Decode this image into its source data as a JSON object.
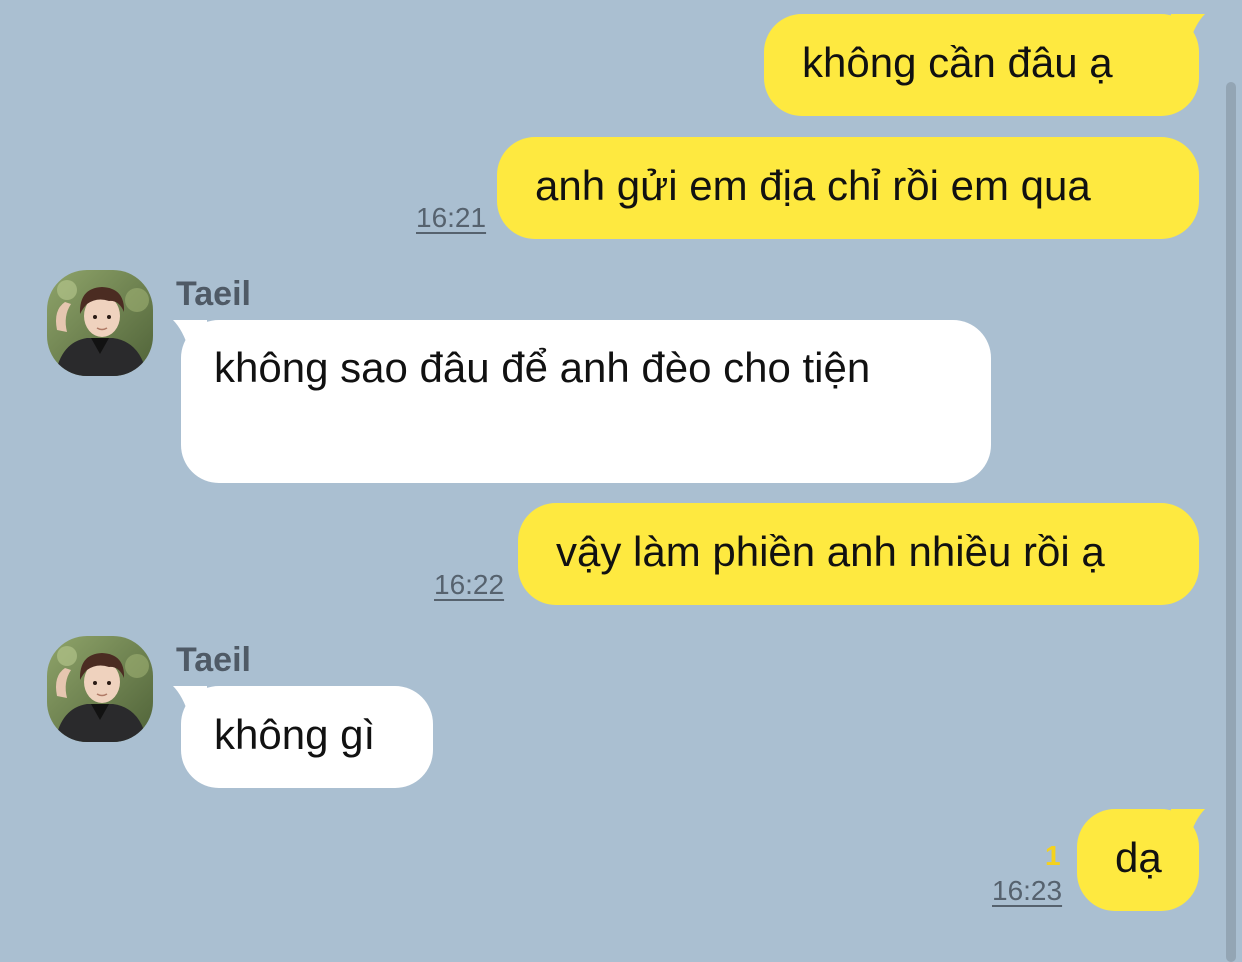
{
  "colors": {
    "background": "#aabfd1",
    "my_bubble": "#fee940",
    "other_bubble": "#ffffff",
    "time_text": "#56626e",
    "unread_badge": "#f5d21d"
  },
  "messages": [
    {
      "id": "m1",
      "side": "me",
      "text": "không cần đâu ạ",
      "time": "",
      "unread": ""
    },
    {
      "id": "m2",
      "side": "me",
      "text": "anh gửi em địa chỉ rồi em qua",
      "time": "16:21",
      "unread": ""
    },
    {
      "id": "m3",
      "side": "other",
      "sender": "Taeil",
      "avatar_icon": "avatar-photo",
      "text": "không sao đâu để anh đèo cho tiện",
      "time": ""
    },
    {
      "id": "m4",
      "side": "me",
      "text": "vậy làm phiền anh nhiều rồi ạ",
      "time": "16:22",
      "unread": ""
    },
    {
      "id": "m5",
      "side": "other",
      "sender": "Taeil",
      "avatar_icon": "avatar-photo",
      "text": "không gì",
      "time": ""
    },
    {
      "id": "m6",
      "side": "me",
      "text": "dạ",
      "time": "16:23",
      "unread": "1"
    }
  ]
}
